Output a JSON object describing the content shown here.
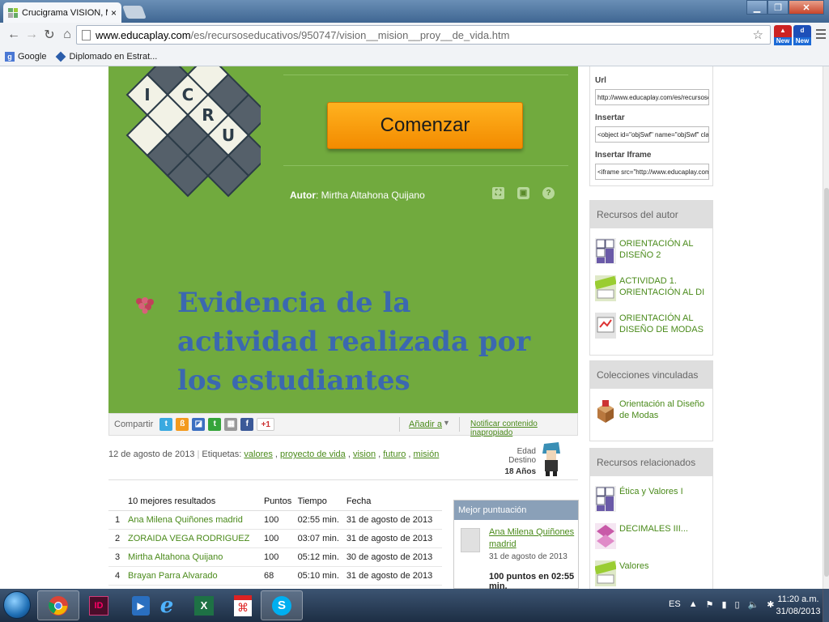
{
  "browser": {
    "tab_title": "Crucigrama VISION, MISIO",
    "tab_close": "×",
    "url_host": "www.educaplay.com",
    "url_path": "/es/recursoseducativos/950747/vision__mision__proy__de_vida.htm",
    "ext1_label": "New",
    "ext2_label": "New",
    "bookmarks": [
      "Google",
      "Diplomado en Estrat..."
    ]
  },
  "activity": {
    "logo_letters": [
      "I",
      "C",
      "R",
      "U"
    ],
    "start_button": "Comenzar",
    "author_label": "Autor",
    "author_name": ": Mirtha Altahona Quijano",
    "overlay_text": "Evidencia de la actividad realizada por los estudiantes"
  },
  "share": {
    "label": "Compartir",
    "add_to": "Añadir a",
    "report": "Notificar contenido inapropiado",
    "gplus": "+1"
  },
  "meta": {
    "date": "12 de agosto de 2013",
    "tags_label": "Etiquetas:",
    "tags": [
      "valores",
      "proyecto de vida",
      "vision",
      "futuro",
      "misión"
    ],
    "age_label": "Edad Destino",
    "age_value": "18 Años"
  },
  "results": {
    "headers": [
      "10 mejores resultados",
      "Puntos",
      "Tiempo",
      "Fecha"
    ],
    "rows": [
      {
        "rank": "1",
        "name": "Ana Milena Quiñones madrid",
        "points": "100",
        "time": "02:55 min.",
        "date": "31 de agosto de 2013"
      },
      {
        "rank": "2",
        "name": "ZORAIDA VEGA RODRIGUEZ",
        "points": "100",
        "time": "03:07 min.",
        "date": "31 de agosto de 2013"
      },
      {
        "rank": "3",
        "name": "Mirtha Altahona Quijano",
        "points": "100",
        "time": "05:12 min.",
        "date": "30 de agosto de 2013"
      },
      {
        "rank": "4",
        "name": "Brayan Parra Alvarado",
        "points": "68",
        "time": "05:10 min.",
        "date": "31 de agosto de 2013"
      }
    ]
  },
  "best_score": {
    "title": "Mejor puntuación",
    "name": "Ana Milena Quiñones madrid",
    "date": "31 de agosto de 2013",
    "summary": "100 puntos en 02:55 min."
  },
  "sidebar": {
    "embed": {
      "url_label": "Url",
      "url_value": "http://www.educaplay.com/es/recursose",
      "insert_label": "Insertar",
      "insert_value": "<object id=\"objSwf\" name=\"objSwf\" cla",
      "iframe_label": "Insertar Iframe",
      "iframe_value": "<iframe src=\"http://www.educaplay.com/"
    },
    "author_resources": {
      "title": "Recursos del autor",
      "items": [
        "ORIENTACIÓN AL DISEÑO 2",
        "ACTIVIDAD 1. ORIENTACIÓN AL DI",
        "ORIENTACIÓN AL DISEÑO DE MODAS"
      ]
    },
    "collections": {
      "title": "Colecciones vinculadas",
      "items": [
        "Orientación al Diseño de Modas"
      ]
    },
    "related": {
      "title": "Recursos relacionados",
      "items": [
        "Ética y Valores I",
        "DECIMALES III...",
        "Valores"
      ]
    }
  },
  "taskbar": {
    "language": "ES",
    "time": "11:20 a.m.",
    "date": "31/08/2013"
  }
}
